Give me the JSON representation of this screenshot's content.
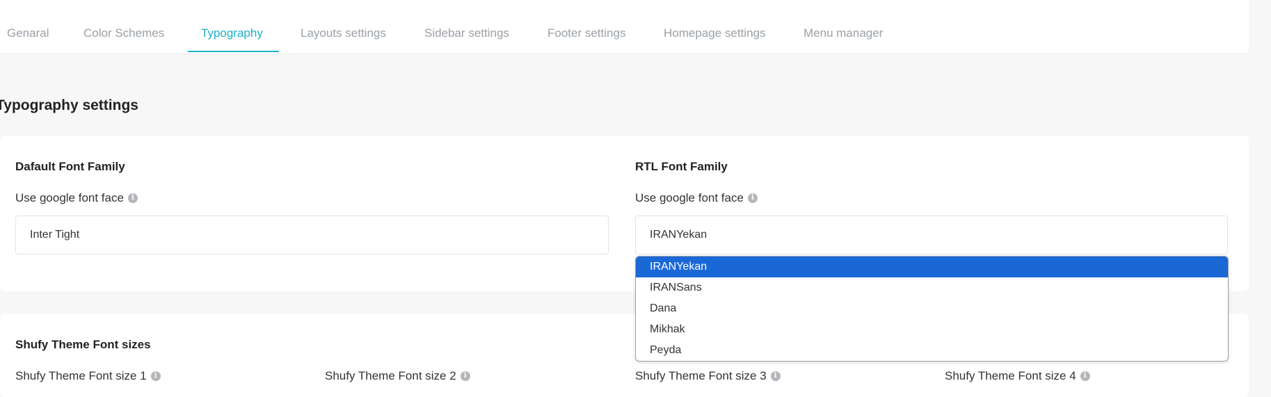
{
  "tabs": [
    {
      "label": "Genaral",
      "active": false
    },
    {
      "label": "Color Schemes",
      "active": false
    },
    {
      "label": "Typography",
      "active": true
    },
    {
      "label": "Layouts settings",
      "active": false
    },
    {
      "label": "Sidebar settings",
      "active": false
    },
    {
      "label": "Footer settings",
      "active": false
    },
    {
      "label": "Homepage settings",
      "active": false
    },
    {
      "label": "Menu manager",
      "active": false
    }
  ],
  "section_title": "Typography settings",
  "default_font": {
    "title": "Dafault Font Family",
    "subtitle": "Use google font face",
    "value": "Inter Tight"
  },
  "rtl_font": {
    "title": "RTL Font Family",
    "subtitle": "Use google font face",
    "value": "IRANYekan",
    "options": [
      "IRANYekan",
      "IRANSans",
      "Dana",
      "Mikhak",
      "Peyda"
    ],
    "selected_index": 0
  },
  "font_sizes": {
    "title": "Shufy Theme Font sizes",
    "labels": [
      "Shufy Theme Font size 1",
      "Shufy Theme Font size 2",
      "Shufy Theme Font size 3",
      "Shufy Theme Font size 4"
    ]
  },
  "info_glyph": "i",
  "colors": {
    "accent": "#19b3c8",
    "selected_option": "#1a68d6",
    "tab_inactive": "#9aa0a6"
  }
}
